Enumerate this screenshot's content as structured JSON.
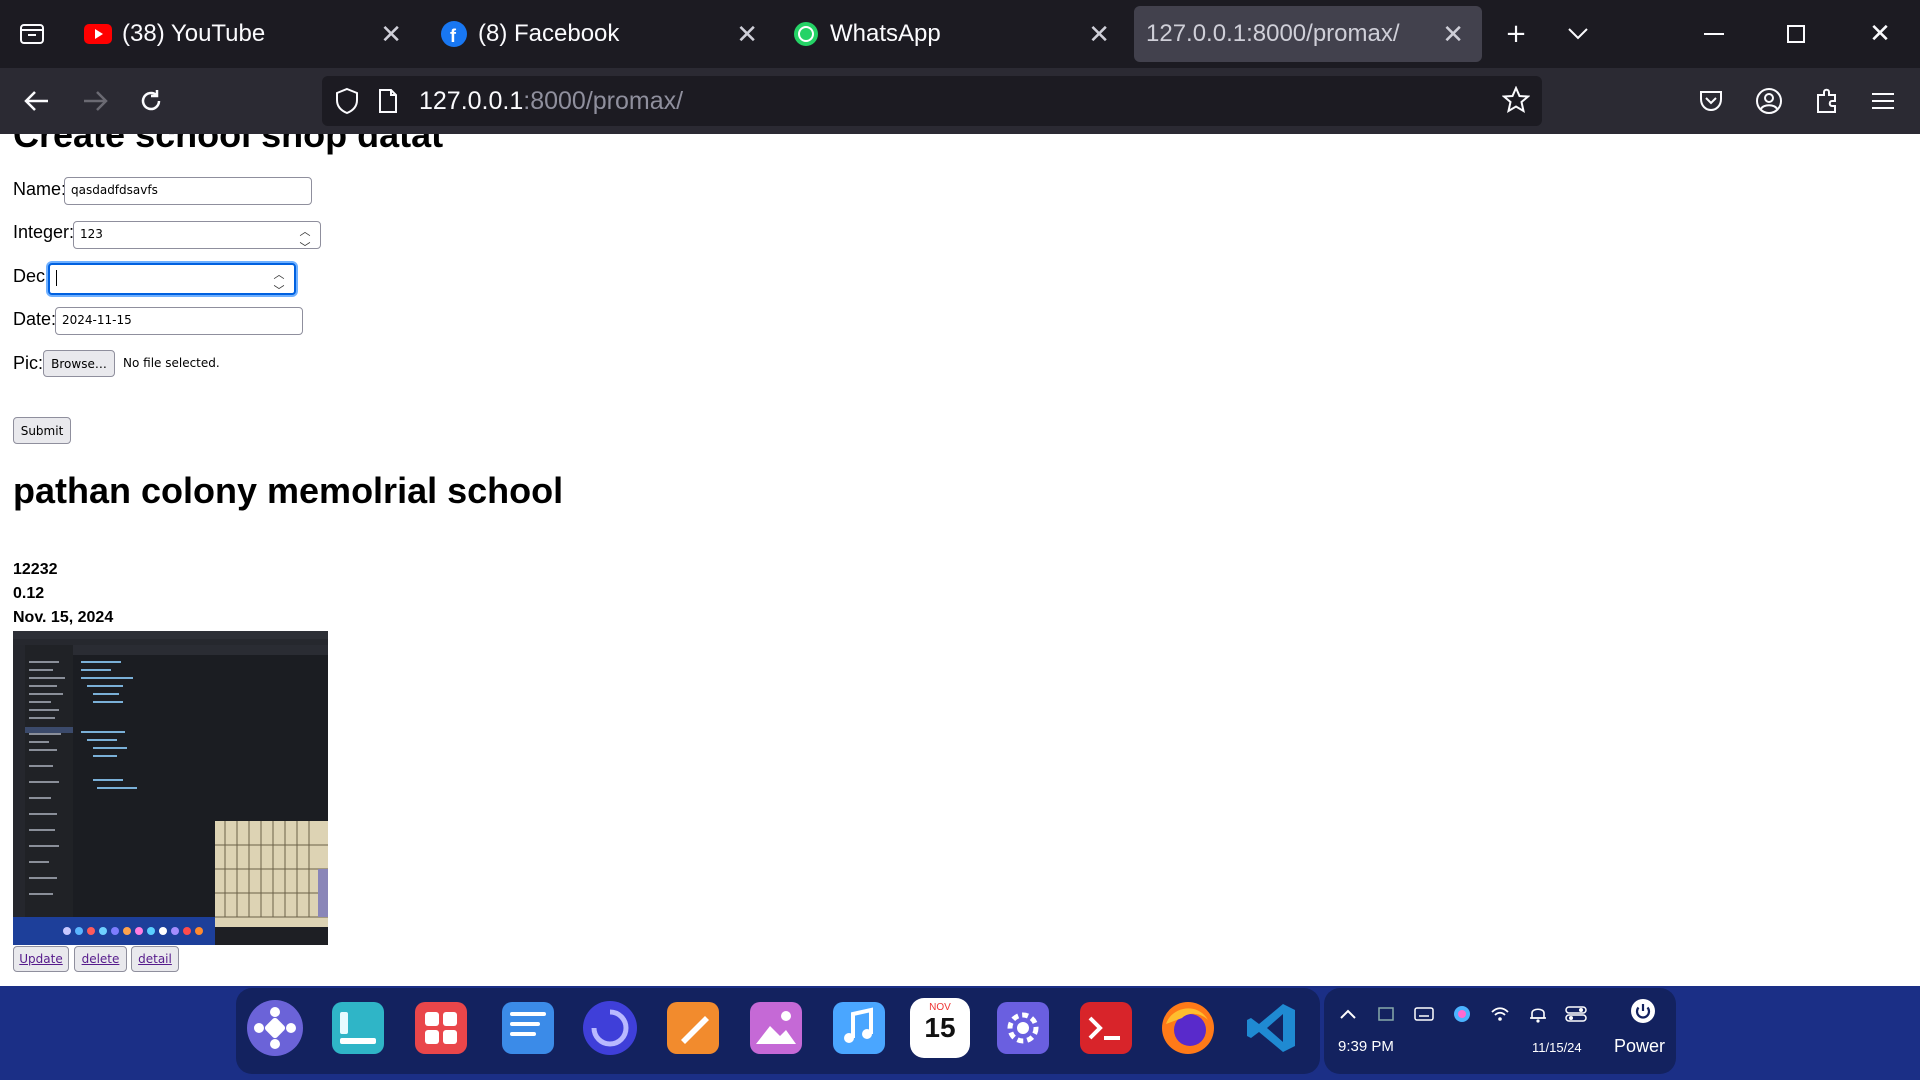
{
  "browser": {
    "tabs": [
      {
        "title": "(38) YouTube",
        "icon": "youtube-icon",
        "color": "#ff0000"
      },
      {
        "title": "(8) Facebook",
        "icon": "facebook-icon",
        "color": "#1877f2"
      },
      {
        "title": "WhatsApp",
        "icon": "whatsapp-icon",
        "color": "#25d366"
      },
      {
        "title": "127.0.0.1:8000/promax/",
        "icon": "",
        "active": true
      }
    ],
    "url_host": "127.0.0.1",
    "url_rest": ":8000/promax/"
  },
  "form": {
    "heading": "Create school shop datat",
    "name_label": "Name:",
    "name_value": "qasdadfdsavfs",
    "integer_label": "Integer:",
    "integer_value": "123",
    "dec_label": "Dec:",
    "dec_value": "",
    "date_label": "Date:",
    "date_value": "2024-11-15",
    "pic_label": "Pic:",
    "browse_label": "Browse…",
    "file_status": "No file selected.",
    "submit_label": "Submit"
  },
  "record": {
    "school_name": "pathan colony memolrial school",
    "integer": "12232",
    "decimal": "0.12",
    "date": "Nov. 15, 2024",
    "actions": [
      "Update",
      "delete",
      "detail"
    ]
  },
  "taskbar": {
    "calendar_month": "NOV",
    "calendar_day": "15",
    "time": "9:39 PM",
    "date": "11/15/24",
    "power_label": "Power"
  },
  "colors": {
    "tab_bg": "#1c1b22",
    "nav_bg": "#2b2a33",
    "taskbar_bg": "#1b2f86",
    "focus": "#0061e0"
  }
}
